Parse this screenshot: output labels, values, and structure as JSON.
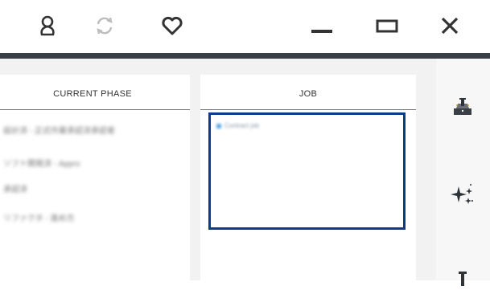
{
  "titlebar": {
    "icons": [
      "user-icon",
      "sync-icon",
      "heart-icon",
      "minimize-icon",
      "maximize-icon",
      "close-icon"
    ]
  },
  "phase_panel": {
    "header": "CURRENT PHASE",
    "items": [
      "設計済 - 正式作業承認済承認者",
      "ソフト開発済 - Appro",
      "承認済",
      "リファクタ - 進め方"
    ]
  },
  "job_panel": {
    "header": "JOB",
    "selected_item": "Contract job"
  },
  "right_rail": {
    "icons": [
      "wizard-tool-icon",
      "sparkle-icon",
      "tool-icon"
    ]
  },
  "colors": {
    "selection_border": "#0d3b8c",
    "dark_rule": "#3a3f45",
    "job_bullet": "#5aa9e6"
  }
}
